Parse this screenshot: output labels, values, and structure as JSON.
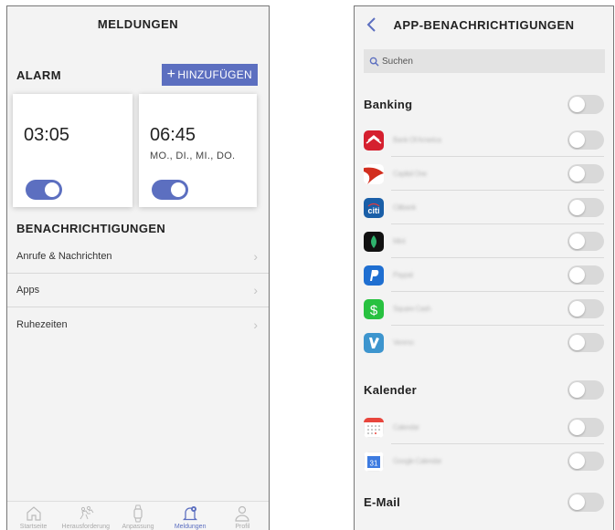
{
  "left": {
    "title": "MELDUNGEN",
    "alarm_title": "ALARM",
    "add_label": "HINZUFÜGEN",
    "add_plus": "+",
    "alarms": [
      {
        "time": "03:05",
        "days": "",
        "enabled": true
      },
      {
        "time": "06:45",
        "days": "MO., DI., MI., DO.",
        "enabled": true
      }
    ],
    "notifications_title": "BENACHRICHTIGUNGEN",
    "menu": [
      "Anrufe & Nachrichten",
      "Apps",
      "Ruhezeiten"
    ],
    "chevron": "›",
    "tabs": [
      "Startseite",
      "Herausforderung",
      "Anpassung",
      "Meldungen",
      "Profil"
    ],
    "active_tab": "Meldungen",
    "accent_color": "#5c6fc0"
  },
  "right": {
    "title": "APP-BENACHRICHTIGUNGEN",
    "search_placeholder": "Suchen",
    "sections": [
      {
        "title": "Banking",
        "enabled": false
      },
      {
        "title": "Kalender",
        "enabled": false
      },
      {
        "title": "E-Mail",
        "enabled": false
      }
    ],
    "banking_apps": [
      {
        "icon": "bank-of-america-icon",
        "name": "Bank Of America",
        "enabled": false
      },
      {
        "icon": "capital-one-icon",
        "name": "Capital One",
        "enabled": false
      },
      {
        "icon": "citi-icon",
        "name": "Citibank",
        "enabled": false
      },
      {
        "icon": "mint-icon",
        "name": "Mint",
        "enabled": false
      },
      {
        "icon": "paypal-icon",
        "name": "Paypal",
        "enabled": false
      },
      {
        "icon": "cash-app-icon",
        "name": "Square Cash",
        "enabled": false
      },
      {
        "icon": "venmo-icon",
        "name": "Venmo",
        "enabled": false
      }
    ],
    "calendar_apps": [
      {
        "icon": "calendar-icon",
        "name": "Calendar",
        "enabled": false
      },
      {
        "icon": "google-calendar-icon",
        "name": "Google Calendar",
        "enabled": false
      }
    ],
    "citi_text": "citi",
    "gcal_day": "31"
  }
}
